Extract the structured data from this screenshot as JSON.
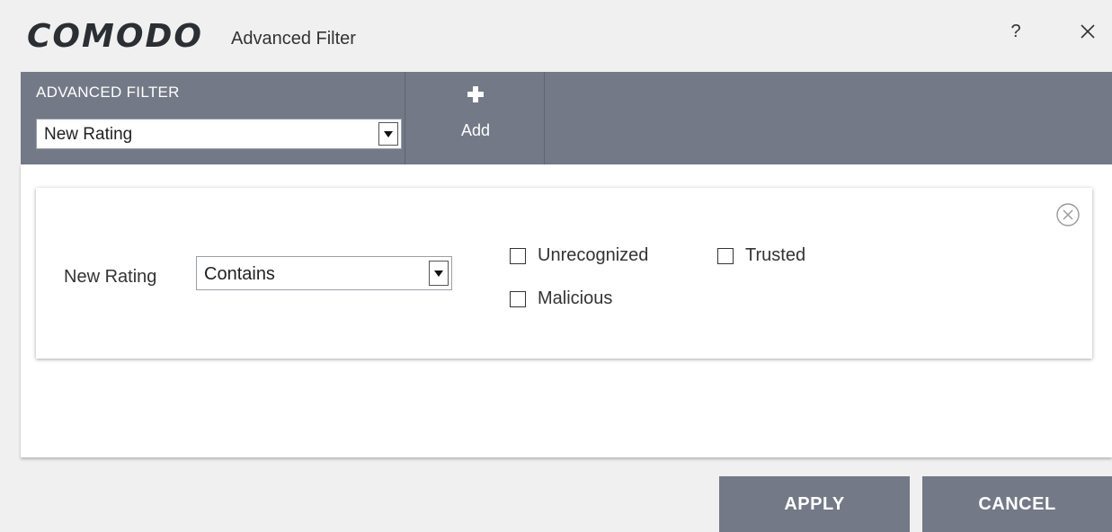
{
  "window": {
    "logo_text": "COMODO",
    "title": "Advanced Filter",
    "help_label": "?"
  },
  "toolbar": {
    "filter_label": "ADVANCED FILTER",
    "filter_select_value": "New Rating",
    "add_label": "Add"
  },
  "criteria": {
    "label": "New Rating",
    "operator_value": "Contains",
    "checkboxes": [
      {
        "label": "Unrecognized",
        "checked": false
      },
      {
        "label": "Trusted",
        "checked": false
      },
      {
        "label": "Malicious",
        "checked": false
      }
    ]
  },
  "footer": {
    "apply_label": "APPLY",
    "cancel_label": "CANCEL"
  },
  "colors": {
    "toolbar_bg": "#737986",
    "button_bg": "#737986",
    "window_bg": "#f0f0f0"
  },
  "icons": {
    "add": "plus-icon",
    "close": "close-icon",
    "remove": "circle-x-icon",
    "dropdown": "chevron-down-icon"
  }
}
